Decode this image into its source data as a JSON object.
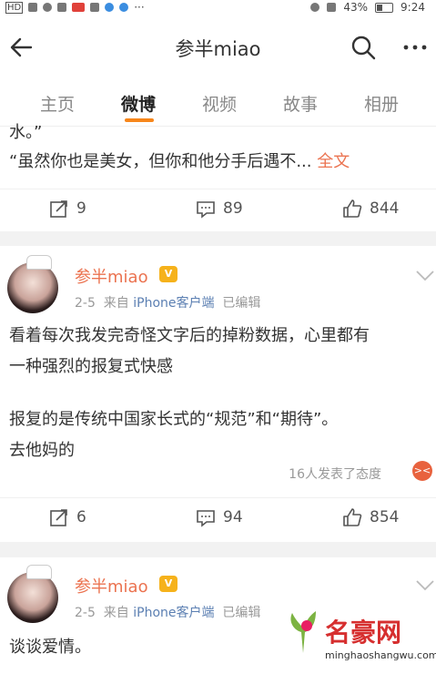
{
  "status_bar": {
    "battery": "43%",
    "time": "9:24",
    "left_tag": "HD"
  },
  "header": {
    "title": "参半miao"
  },
  "tabs": [
    {
      "label": "主页"
    },
    {
      "label": "微博"
    },
    {
      "label": "视频"
    },
    {
      "label": "故事"
    },
    {
      "label": "相册"
    }
  ],
  "post1": {
    "text_top": "水。”",
    "text": "“虽然你也是美女，但你和他分手后遇不...",
    "full_link": "全文",
    "reposts": "9",
    "comments": "89",
    "likes": "844"
  },
  "post2": {
    "username": "参半miao",
    "date": "2-5",
    "source_prefix": "来自",
    "source": "iPhone客户端",
    "edited": "已编辑",
    "lines": [
      "看着每次我发完奇怪文字后的掉粉数据，心里都有",
      "一种强烈的报复式快感",
      "报复的是传统中国家长式的“规范”和“期待”。",
      "去他妈的"
    ],
    "reaction_text": "16人发表了态度",
    "reposts": "6",
    "comments": "94",
    "likes": "854"
  },
  "post3": {
    "username": "参半miao",
    "date": "2-5",
    "source_prefix": "来自",
    "source": "iPhone客户端",
    "edited": "已编辑",
    "text": "谈谈爱情。"
  },
  "watermark": {
    "title": "名豪网",
    "url": "minghaoshangwu.com"
  }
}
